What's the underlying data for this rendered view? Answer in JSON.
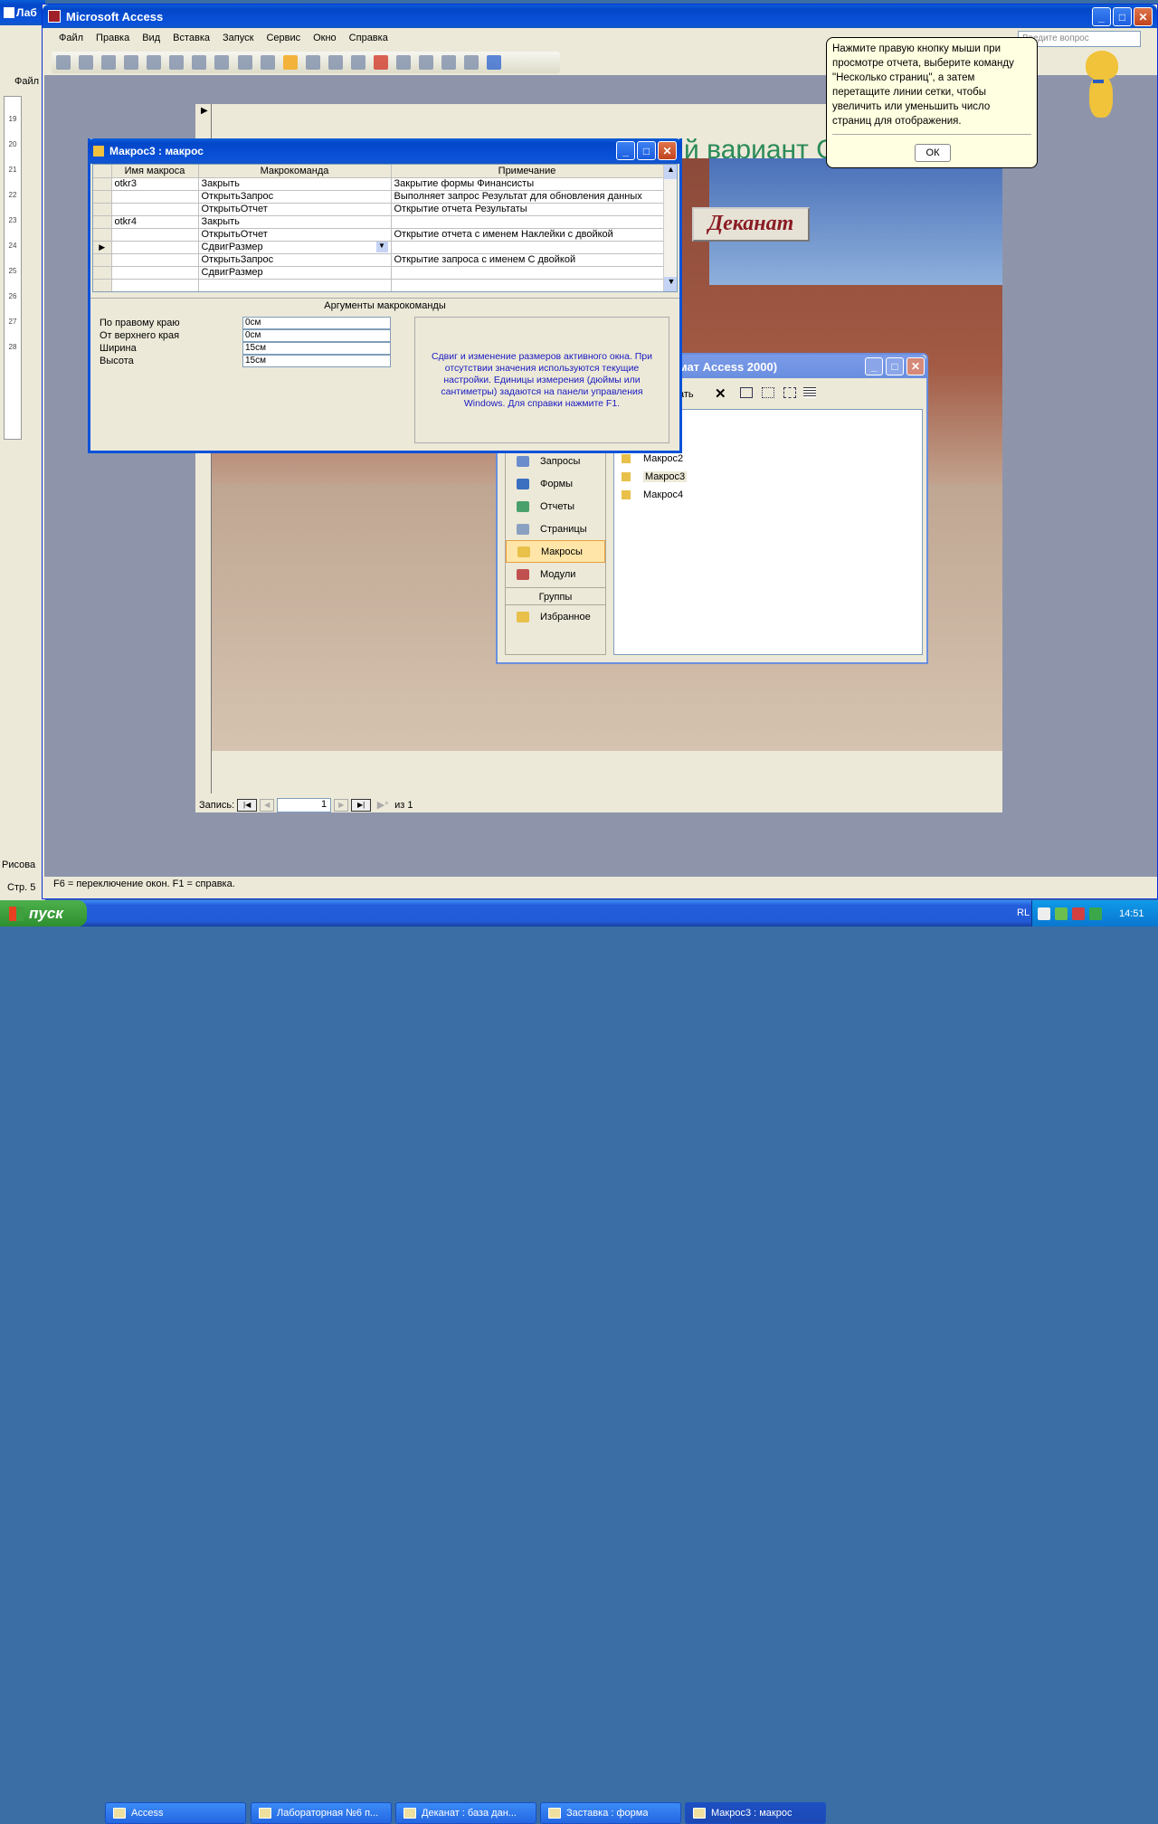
{
  "access": {
    "title": "Microsoft Access",
    "menu": [
      "Файл",
      "Правка",
      "Вид",
      "Вставка",
      "Запуск",
      "Сервис",
      "Окно",
      "Справка"
    ],
    "help_placeholder": "Введите вопрос",
    "statusbar": "F6 = переключение окон.  F1 = справка."
  },
  "bg_word": {
    "title_fragment": "Лаб",
    "menu_fragment": "Файл",
    "status_fragment": "Стр. 5",
    "draw_fragment": "Рисова",
    "ruler_numbers": [
      "19",
      "20",
      "21",
      "22",
      "23",
      "24",
      "25",
      "26",
      "27",
      "28"
    ]
  },
  "form": {
    "title_text": "й вариант С",
    "deanat_button": "Деканат",
    "record_label": "Запись:",
    "record_current": "1",
    "record_of": "из",
    "record_total": "1"
  },
  "macro_window": {
    "title": "Макрос3 : макрос",
    "columns": [
      "Имя макроса",
      "Макрокоманда",
      "Примечание"
    ],
    "rows": [
      {
        "name": "otkr3",
        "action": "Закрыть",
        "note": "Закрытие формы Финансисты"
      },
      {
        "name": "",
        "action": "ОткрытьЗапрос",
        "note": "Выполняет запрос Результат для обновления данных"
      },
      {
        "name": "",
        "action": "ОткрытьОтчет",
        "note": "Открытие отчета Результаты"
      },
      {
        "name": "otkr4",
        "action": "Закрыть",
        "note": ""
      },
      {
        "name": "",
        "action": "ОткрытьОтчет",
        "note": "Открытие отчета с именем Наклейки с двойкой"
      },
      {
        "name": "",
        "action": "СдвигРазмер",
        "note": ""
      },
      {
        "name": "",
        "action": "ОткрытьЗапрос",
        "note": "Открытие запроса с именем С двойкой"
      },
      {
        "name": "",
        "action": "СдвигРазмер",
        "note": ""
      }
    ],
    "current_row": 5,
    "args_header": "Аргументы макрокоманды",
    "args": [
      {
        "label": "По правому краю",
        "value": "0см"
      },
      {
        "label": "От верхнего края",
        "value": "0см"
      },
      {
        "label": "Ширина",
        "value": "15см"
      },
      {
        "label": "Высота",
        "value": "15см"
      }
    ],
    "help_text": "Сдвиг и изменение размеров активного окна. При отсутствии значения используются текущие настройки. Единицы измерения (дюймы или сантиметры) задаются на панели управления Windows. Для справки нажмите F1."
  },
  "db_window": {
    "title_fragment": "мат Access 2000)",
    "toolbar_fragment": "ать",
    "nav": [
      "Запросы",
      "Формы",
      "Отчеты",
      "Страницы",
      "Макросы",
      "Модули"
    ],
    "nav_selected": 4,
    "groups_label": "Группы",
    "favorites": "Избранное",
    "items": [
      "Макрос2",
      "Макрос3",
      "Макрос4"
    ]
  },
  "assistant": {
    "text": "Нажмите правую кнопку мыши при просмотре отчета, выберите команду \"Несколько страниц\", а затем перетащите линии сетки, чтобы увеличить или уменьшить число страниц для отображения.",
    "ok": "ОК"
  },
  "taskbar": {
    "start": "пуск",
    "buttons": [
      "Access",
      "Лабораторная №6 п...",
      "Деканат : база дан...",
      "Заставка : форма",
      "Макрос3 : макрос"
    ],
    "active": 4,
    "lang": "RL",
    "clock": "14:51"
  }
}
